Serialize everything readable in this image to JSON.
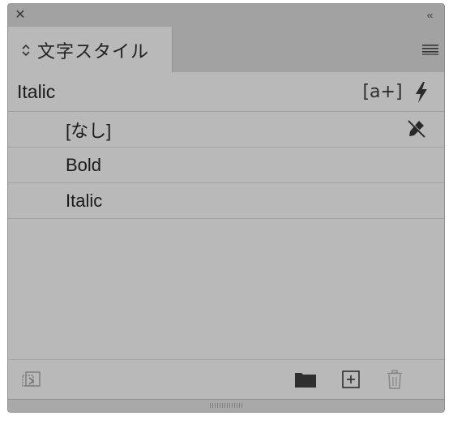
{
  "panel": {
    "tab_label": "文字スタイル",
    "current_style": "Italic",
    "clear_overrides_label": "[a+]"
  },
  "styles": [
    {
      "label": "[なし]",
      "locked": true
    },
    {
      "label": "Bold",
      "locked": false
    },
    {
      "label": "Italic",
      "locked": false
    }
  ],
  "icons": {
    "close": "close-icon",
    "collapse": "double-chevron-left-icon",
    "tab_toggle": "up-down-arrows-icon",
    "panel_menu": "hamburger-menu-icon",
    "clear_overrides": "clear-overrides-icon",
    "quick_apply": "lightning-bolt-icon",
    "locked": "pencil-crossed-icon",
    "load_styles": "load-styles-icon",
    "new_group": "folder-icon",
    "new_style": "add-new-icon",
    "delete": "trash-icon"
  },
  "colors": {
    "panel_bg": "#b9b9b9",
    "header_bg": "#a2a2a2",
    "text": "#1a1a1a"
  }
}
